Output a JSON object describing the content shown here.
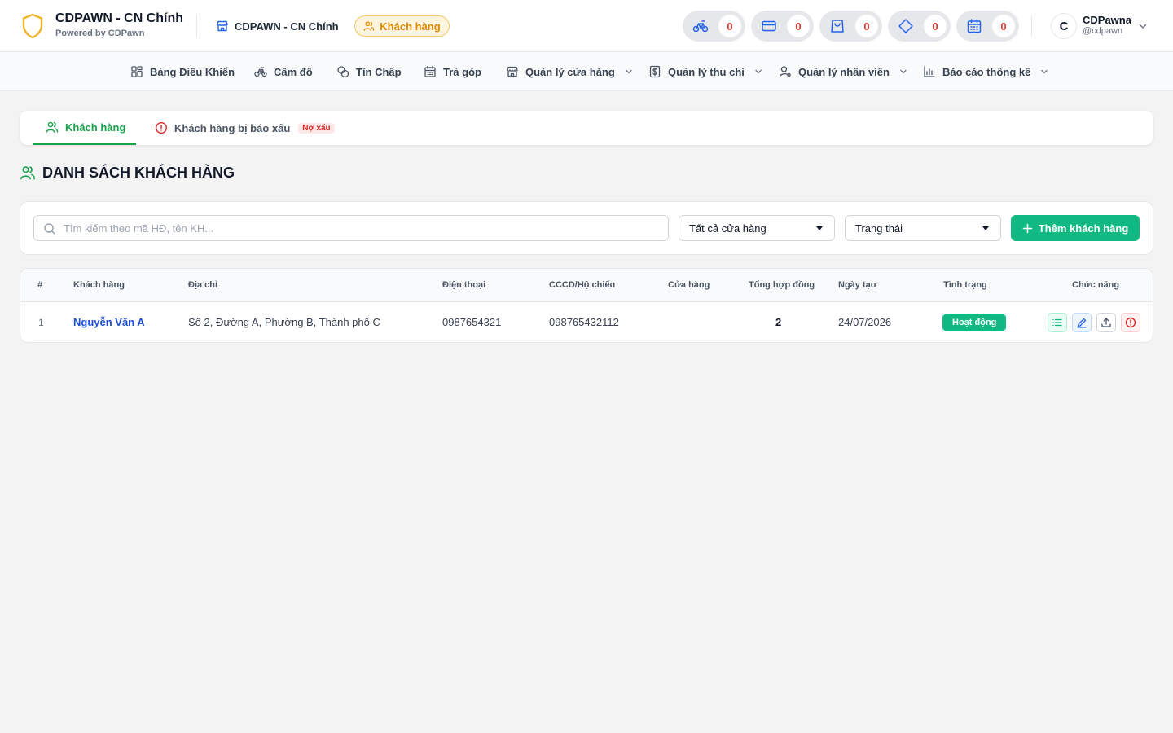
{
  "brand": {
    "title": "CDPAWN - CN Chính",
    "subtitle": "Powered by CDPawn"
  },
  "header": {
    "branch": "CDPAWN - CN Chính",
    "active_pill": "Khách hàng",
    "counters": [
      {
        "icon": "bike-icon",
        "value": "0"
      },
      {
        "icon": "card-icon",
        "value": "0"
      },
      {
        "icon": "bag-icon",
        "value": "0"
      },
      {
        "icon": "diamond-icon",
        "value": "0"
      },
      {
        "icon": "calendar-icon",
        "value": "0"
      }
    ],
    "user": {
      "initial": "C",
      "name": "CDPawna",
      "handle": "@cdpawn"
    }
  },
  "nav": {
    "items": [
      {
        "label": "Bảng Điều Khiển",
        "icon": "dashboard-icon"
      },
      {
        "label": "Cầm đồ",
        "icon": "bike-icon"
      },
      {
        "label": "Tín Chấp",
        "icon": "coins-icon"
      },
      {
        "label": "Trả góp",
        "icon": "calendar-icon"
      },
      {
        "label": "Quản lý cửa hàng",
        "icon": "store-icon"
      },
      {
        "label": "Quản lý thu chi",
        "icon": "dollar-icon"
      },
      {
        "label": "Quản lý nhân viên",
        "icon": "user-cog-icon"
      },
      {
        "label": "Báo cáo thống kê",
        "icon": "bar-chart-icon"
      }
    ]
  },
  "tabs": {
    "customers": "Khách hàng",
    "reported": "Khách hàng bị báo xấu",
    "reported_tag": "Nợ xấu"
  },
  "page": {
    "title": "DANH SÁCH KHÁCH HÀNG"
  },
  "filters": {
    "search_placeholder": "Tìm kiếm theo mã HĐ, tên KH...",
    "store_select": "Tất cả cửa hàng",
    "status_select": "Trạng thái",
    "add_button": "Thêm khách hàng"
  },
  "table": {
    "columns": {
      "index": "#",
      "customer": "Khách hàng",
      "address": "Địa chỉ",
      "phone": "Điện thoại",
      "id_card": "CCCD/Hộ chiếu",
      "store": "Cửa hàng",
      "contracts": "Tổng hợp đồng",
      "created": "Ngày tạo",
      "status": "Tình trạng",
      "actions": "Chức năng"
    },
    "rows": [
      {
        "index": "1",
        "customer": "Nguyễn Văn A",
        "address": "Số 2, Đường A, Phường B, Thành phố C",
        "phone": "0987654321",
        "id_card": "098765432112",
        "store": "",
        "contracts": "2",
        "created": "24/07/2026",
        "status": "Hoạt động"
      }
    ]
  },
  "colors": {
    "accent": "#10b981",
    "link": "#1d4ed8",
    "danger": "#e53935",
    "warning": "#d98a00"
  }
}
